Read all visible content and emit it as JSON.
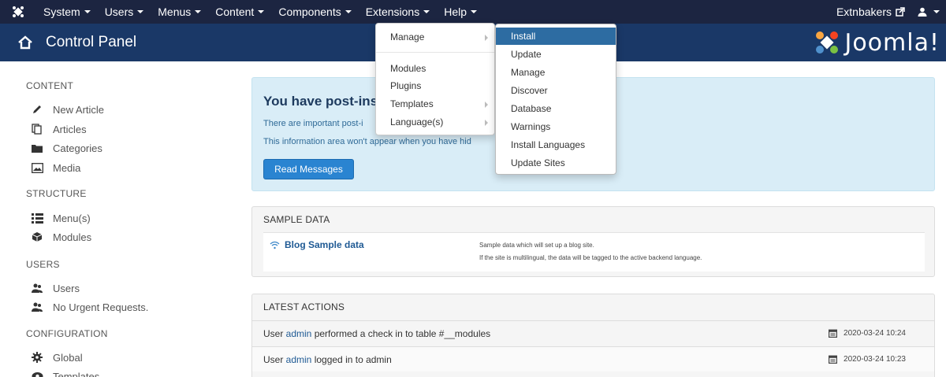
{
  "topnav": {
    "menus": [
      {
        "label": "System"
      },
      {
        "label": "Users"
      },
      {
        "label": "Menus"
      },
      {
        "label": "Content"
      },
      {
        "label": "Components"
      },
      {
        "label": "Extensions"
      },
      {
        "label": "Help"
      }
    ],
    "site_link": "Extnbakers",
    "user_menu": "user"
  },
  "header": {
    "title": "Control Panel",
    "brand": "Joomla!"
  },
  "sidebar": {
    "sections": [
      {
        "title": "CONTENT",
        "items": [
          {
            "label": "New Article",
            "icon": "pencil-icon"
          },
          {
            "label": "Articles",
            "icon": "stack-icon"
          },
          {
            "label": "Categories",
            "icon": "folder-icon"
          },
          {
            "label": "Media",
            "icon": "image-icon"
          }
        ]
      },
      {
        "title": "STRUCTURE",
        "items": [
          {
            "label": "Menu(s)",
            "icon": "list-icon"
          },
          {
            "label": "Modules",
            "icon": "cube-icon"
          }
        ]
      },
      {
        "title": "USERS",
        "items": [
          {
            "label": "Users",
            "icon": "users-icon"
          },
          {
            "label": "No Urgent Requests.",
            "icon": "users-icon"
          }
        ]
      },
      {
        "title": "CONFIGURATION",
        "items": [
          {
            "label": "Global",
            "icon": "cog-icon"
          },
          {
            "label": "Templates",
            "icon": "eye-icon"
          }
        ]
      }
    ]
  },
  "postinstall": {
    "heading": "You have post-ins",
    "line1": "There are important post-i",
    "line2": "This information area won't appear when you have hid",
    "button": "Read Messages"
  },
  "sample_data": {
    "header": "SAMPLE DATA",
    "link": "Blog Sample data",
    "desc1": "Sample data which will set up a blog site.",
    "desc2": "If the site is multilingual, the data will be tagged to the active backend language."
  },
  "latest_actions": {
    "header": "LATEST ACTIONS",
    "rows": [
      {
        "pre": "User ",
        "user": "admin",
        "post": " performed a check in to table #__modules",
        "date": "2020-03-24 10:24"
      },
      {
        "pre": "User ",
        "user": "admin",
        "post": " logged in to admin",
        "date": "2020-03-24 10:23"
      }
    ]
  },
  "extensions_menu": {
    "items": [
      {
        "label": "Manage",
        "submenu": true
      },
      {
        "label": "Modules",
        "submenu": false
      },
      {
        "label": "Plugins",
        "submenu": false
      },
      {
        "label": "Templates",
        "submenu": true
      },
      {
        "label": "Language(s)",
        "submenu": true
      }
    ]
  },
  "manage_submenu": {
    "items": [
      {
        "label": "Install",
        "highlighted": true
      },
      {
        "label": "Update"
      },
      {
        "label": "Manage"
      },
      {
        "label": "Discover"
      },
      {
        "label": "Database"
      },
      {
        "label": "Warnings"
      },
      {
        "label": "Install Languages"
      },
      {
        "label": "Update Sites"
      }
    ]
  },
  "colors": {
    "topnav_bg": "#1c2541",
    "header_bg": "#1a3867",
    "alert_bg": "#d9edf7",
    "primary_button": "#2a84d1",
    "menu_highlight": "#2d6ca2"
  }
}
